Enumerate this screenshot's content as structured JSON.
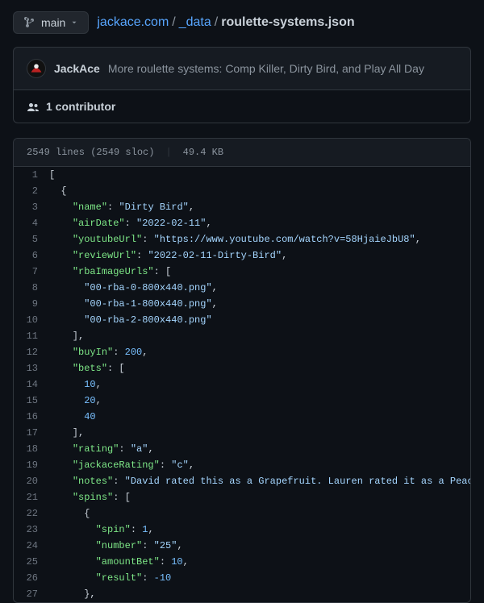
{
  "branch": {
    "label": "main"
  },
  "breadcrumb": {
    "repo": "jackace.com",
    "dir": "_data",
    "file": "roulette-systems.json"
  },
  "commit": {
    "author": "JackAce",
    "message": "More roulette systems: Comp Killer, Dirty Bird, and Play All Day"
  },
  "contributors": {
    "label": "1 contributor"
  },
  "file_meta": {
    "lines": "2549 lines (2549 sloc)",
    "size": "49.4 KB"
  },
  "code_lines": [
    {
      "n": 1,
      "t": [
        [
          "p",
          "["
        ]
      ]
    },
    {
      "n": 2,
      "t": [
        [
          "p",
          "  {"
        ]
      ]
    },
    {
      "n": 3,
      "t": [
        [
          "p",
          "    "
        ],
        [
          "k",
          "\"name\""
        ],
        [
          "p",
          ": "
        ],
        [
          "s",
          "\"Dirty Bird\""
        ],
        [
          "p",
          ","
        ]
      ]
    },
    {
      "n": 4,
      "t": [
        [
          "p",
          "    "
        ],
        [
          "k",
          "\"airDate\""
        ],
        [
          "p",
          ": "
        ],
        [
          "s",
          "\"2022-02-11\""
        ],
        [
          "p",
          ","
        ]
      ]
    },
    {
      "n": 5,
      "t": [
        [
          "p",
          "    "
        ],
        [
          "k",
          "\"youtubeUrl\""
        ],
        [
          "p",
          ": "
        ],
        [
          "s",
          "\"https://www.youtube.com/watch?v=58HjaieJbU8\""
        ],
        [
          "p",
          ","
        ]
      ]
    },
    {
      "n": 6,
      "t": [
        [
          "p",
          "    "
        ],
        [
          "k",
          "\"reviewUrl\""
        ],
        [
          "p",
          ": "
        ],
        [
          "s",
          "\"2022-02-11-Dirty-Bird\""
        ],
        [
          "p",
          ","
        ]
      ]
    },
    {
      "n": 7,
      "t": [
        [
          "p",
          "    "
        ],
        [
          "k",
          "\"rbaImageUrls\""
        ],
        [
          "p",
          ": ["
        ]
      ]
    },
    {
      "n": 8,
      "t": [
        [
          "p",
          "      "
        ],
        [
          "s",
          "\"00-rba-0-800x440.png\""
        ],
        [
          "p",
          ","
        ]
      ]
    },
    {
      "n": 9,
      "t": [
        [
          "p",
          "      "
        ],
        [
          "s",
          "\"00-rba-1-800x440.png\""
        ],
        [
          "p",
          ","
        ]
      ]
    },
    {
      "n": 10,
      "t": [
        [
          "p",
          "      "
        ],
        [
          "s",
          "\"00-rba-2-800x440.png\""
        ]
      ]
    },
    {
      "n": 11,
      "t": [
        [
          "p",
          "    ],"
        ]
      ]
    },
    {
      "n": 12,
      "t": [
        [
          "p",
          "    "
        ],
        [
          "k",
          "\"buyIn\""
        ],
        [
          "p",
          ": "
        ],
        [
          "n",
          "200"
        ],
        [
          "p",
          ","
        ]
      ]
    },
    {
      "n": 13,
      "t": [
        [
          "p",
          "    "
        ],
        [
          "k",
          "\"bets\""
        ],
        [
          "p",
          ": ["
        ]
      ]
    },
    {
      "n": 14,
      "t": [
        [
          "p",
          "      "
        ],
        [
          "n",
          "10"
        ],
        [
          "p",
          ","
        ]
      ]
    },
    {
      "n": 15,
      "t": [
        [
          "p",
          "      "
        ],
        [
          "n",
          "20"
        ],
        [
          "p",
          ","
        ]
      ]
    },
    {
      "n": 16,
      "t": [
        [
          "p",
          "      "
        ],
        [
          "n",
          "40"
        ]
      ]
    },
    {
      "n": 17,
      "t": [
        [
          "p",
          "    ],"
        ]
      ]
    },
    {
      "n": 18,
      "t": [
        [
          "p",
          "    "
        ],
        [
          "k",
          "\"rating\""
        ],
        [
          "p",
          ": "
        ],
        [
          "s",
          "\"a\""
        ],
        [
          "p",
          ","
        ]
      ]
    },
    {
      "n": 19,
      "t": [
        [
          "p",
          "    "
        ],
        [
          "k",
          "\"jackaceRating\""
        ],
        [
          "p",
          ": "
        ],
        [
          "s",
          "\"c\""
        ],
        [
          "p",
          ","
        ]
      ]
    },
    {
      "n": 20,
      "t": [
        [
          "p",
          "    "
        ],
        [
          "k",
          "\"notes\""
        ],
        [
          "p",
          ": "
        ],
        [
          "s",
          "\"David rated this as a Grapefruit. Lauren rated it as a Peach.\""
        ],
        [
          "p",
          ","
        ]
      ]
    },
    {
      "n": 21,
      "t": [
        [
          "p",
          "    "
        ],
        [
          "k",
          "\"spins\""
        ],
        [
          "p",
          ": ["
        ]
      ]
    },
    {
      "n": 22,
      "t": [
        [
          "p",
          "      {"
        ]
      ]
    },
    {
      "n": 23,
      "t": [
        [
          "p",
          "        "
        ],
        [
          "k",
          "\"spin\""
        ],
        [
          "p",
          ": "
        ],
        [
          "n",
          "1"
        ],
        [
          "p",
          ","
        ]
      ]
    },
    {
      "n": 24,
      "t": [
        [
          "p",
          "        "
        ],
        [
          "k",
          "\"number\""
        ],
        [
          "p",
          ": "
        ],
        [
          "s",
          "\"25\""
        ],
        [
          "p",
          ","
        ]
      ]
    },
    {
      "n": 25,
      "t": [
        [
          "p",
          "        "
        ],
        [
          "k",
          "\"amountBet\""
        ],
        [
          "p",
          ": "
        ],
        [
          "n",
          "10"
        ],
        [
          "p",
          ","
        ]
      ]
    },
    {
      "n": 26,
      "t": [
        [
          "p",
          "        "
        ],
        [
          "k",
          "\"result\""
        ],
        [
          "p",
          ": "
        ],
        [
          "n",
          "-10"
        ]
      ]
    },
    {
      "n": 27,
      "t": [
        [
          "p",
          "      },"
        ]
      ]
    }
  ]
}
